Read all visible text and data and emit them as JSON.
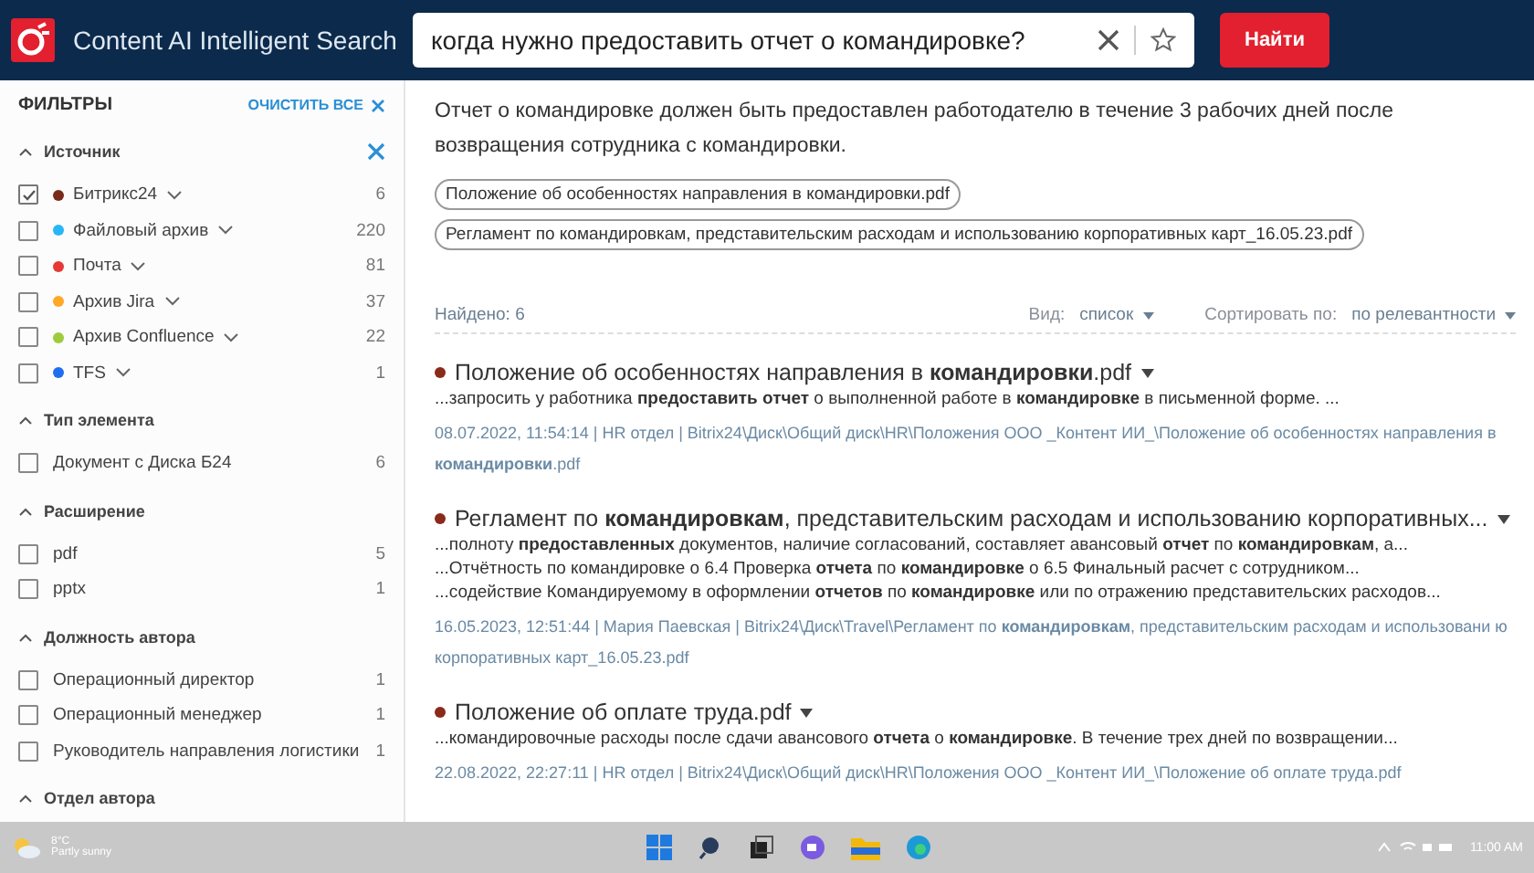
{
  "header": {
    "app_title": "Content AI Intelligent Search",
    "search": {
      "value": "когда нужно предоставить отчет о командировке?"
    },
    "search_button": "Найти"
  },
  "sidebar": {
    "title": "ФИЛЬТРЫ",
    "clear_all": "ОЧИСТИТЬ ВСЕ",
    "sections": [
      {
        "title": "Источник",
        "expanded": true,
        "clearable": true,
        "items": [
          {
            "label": "Битрикс24",
            "count": "6",
            "checked": true,
            "color": "#7a2a1a"
          },
          {
            "label": "Файловый архив",
            "count": "220",
            "checked": false,
            "color": "#29b6f6"
          },
          {
            "label": "Почта",
            "count": "81",
            "checked": false,
            "color": "#e53935"
          },
          {
            "label": "Архив Jira",
            "count": "37",
            "checked": false,
            "color": "#ffa726"
          },
          {
            "label": "Архив Confluence",
            "count": "22",
            "checked": false,
            "color": "#9ccc3c"
          },
          {
            "label": "TFS",
            "count": "1",
            "checked": false,
            "color": "#1e6ff0"
          }
        ]
      },
      {
        "title": "Тип элемента",
        "expanded": true,
        "clearable": false,
        "items": [
          {
            "label": "Документ с Диска Б24",
            "count": "6",
            "checked": false
          }
        ]
      },
      {
        "title": "Расширение",
        "expanded": true,
        "clearable": false,
        "items": [
          {
            "label": "pdf",
            "count": "5",
            "checked": false
          },
          {
            "label": "pptx",
            "count": "1",
            "checked": false
          }
        ]
      },
      {
        "title": "Должность автора",
        "expanded": true,
        "clearable": false,
        "items": [
          {
            "label": "Операционный директор",
            "count": "1",
            "checked": false
          },
          {
            "label": "Операционный менеджер",
            "count": "1",
            "checked": false
          },
          {
            "label": "Руководитель направления логистики",
            "count": "1",
            "checked": false
          }
        ]
      },
      {
        "title": "Отдел автора",
        "expanded": true,
        "clearable": false
      }
    ]
  },
  "answer": {
    "text": "Отчет о командировке должен быть предоставлен работодателю в течение 3 рабочих дней после возвращения сотрудника с командировки.",
    "sources": [
      "Положение об особенностях направления в командировки.pdf",
      "Регламент по командировкам, представительским расходам и использованию корпоративных карт_16.05.23.pdf"
    ]
  },
  "results_bar": {
    "found": "Найдено: 6",
    "view_label": "Вид:",
    "view_value": "список",
    "sort_label": "Сортировать по:",
    "sort_value": "по релевантности"
  },
  "results": [
    {
      "title": "Положение об особенностях направления в **командировки**.pdf",
      "snippets": [
        "...запросить у работника **предоставить отчет** о выполненной работе в **командировке** в письменной форме. ..."
      ],
      "meta": "08.07.2022, 11:54:14 | HR отдел | Bitrix24\\Диск\\Общий диск\\HR\\Положения ООО _Контент ИИ_\\Положение об особенностях направления в **командировки**.pdf"
    },
    {
      "title": "Регламент по **командировкам**, представительским расходам и использованию корпоративных...",
      "snippets": [
        "...полноту **предоставленных** документов, наличие согласований, составляет авансовый **отчет** по **командировкам**, а...",
        "...Отчётность по командировке о 6.4 Проверка **отчета** по **командировке** о 6.5 Финальный расчет с сотрудником...",
        "...содействие Командируемому в оформлении **отчетов** по **командировке** или по отражению представительских расходов..."
      ],
      "meta": "16.05.2023, 12:51:44 | Мария Паевская | Bitrix24\\Диск\\Travel\\Регламент по **командировкам**, представительским расходам и использовани ю корпоративных карт_16.05.23.pdf"
    },
    {
      "title": "Положение об оплате труда.pdf",
      "snippets": [
        "...командировочные расходы после сдачи авансового **отчета** о **командировке**. В течение трех дней по возвращении..."
      ],
      "meta": "22.08.2022, 22:27:11 | HR отдел | Bitrix24\\Диск\\Общий диск\\HR\\Положения ООО _Контент ИИ_\\Положение об оплате труда.pdf"
    }
  ],
  "taskbar": {
    "weather_temp": "8°C",
    "weather_text": "Partly sunny",
    "time": "11:00 AM"
  }
}
